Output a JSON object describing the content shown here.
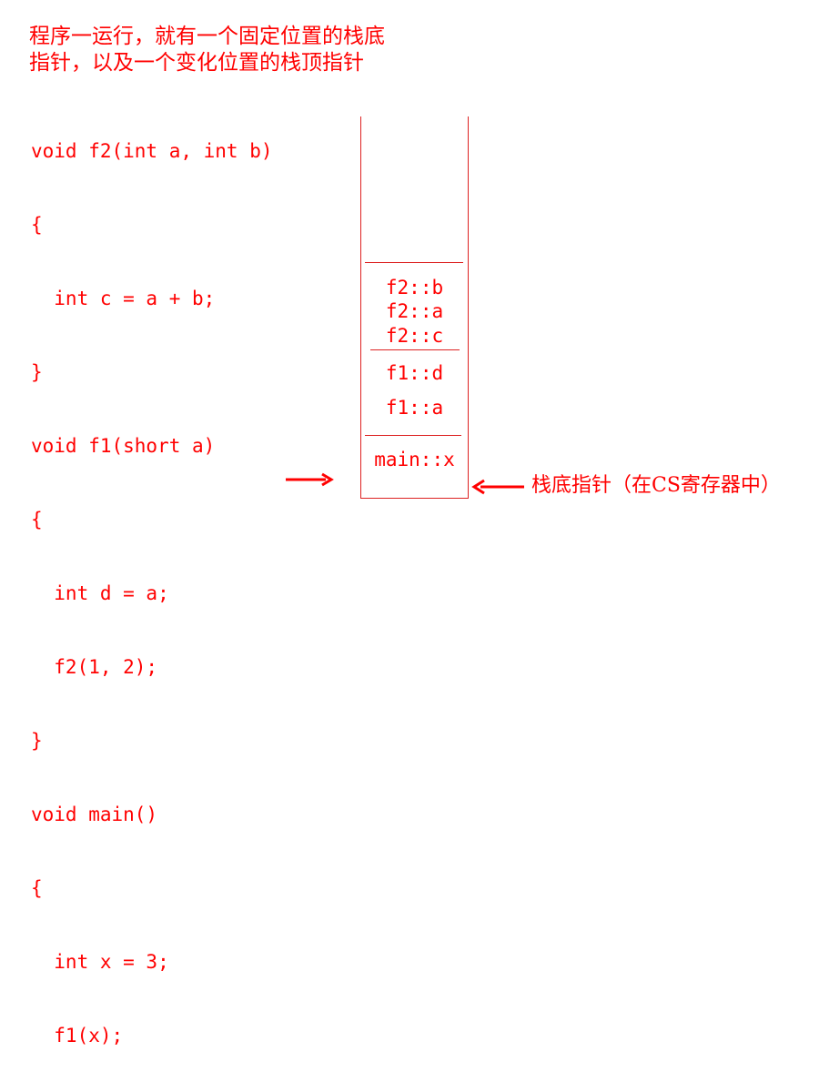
{
  "caption": {
    "line1": "程序一运行，就有一个固定位置的栈底",
    "line2": "指针，以及一个变化位置的栈顶指针"
  },
  "code_lines": [
    "void f2(int a, int b)",
    "{",
    "  int c = a + b;",
    "}",
    "void f1(short a)",
    "{",
    "  int d = a;",
    "  f2(1, 2);",
    "}",
    "void main()",
    "{",
    "  int x = 3;",
    "  f1(x);",
    "}"
  ],
  "stack": {
    "slots": [
      "f2::b",
      "f2::a",
      "f2::c",
      "f1::d",
      "f1::a",
      "main::x"
    ]
  },
  "base_pointer_label": "栈底指针（在CS寄存器中）",
  "colors": {
    "text": "#ff0000",
    "lines": "#dd2222"
  }
}
